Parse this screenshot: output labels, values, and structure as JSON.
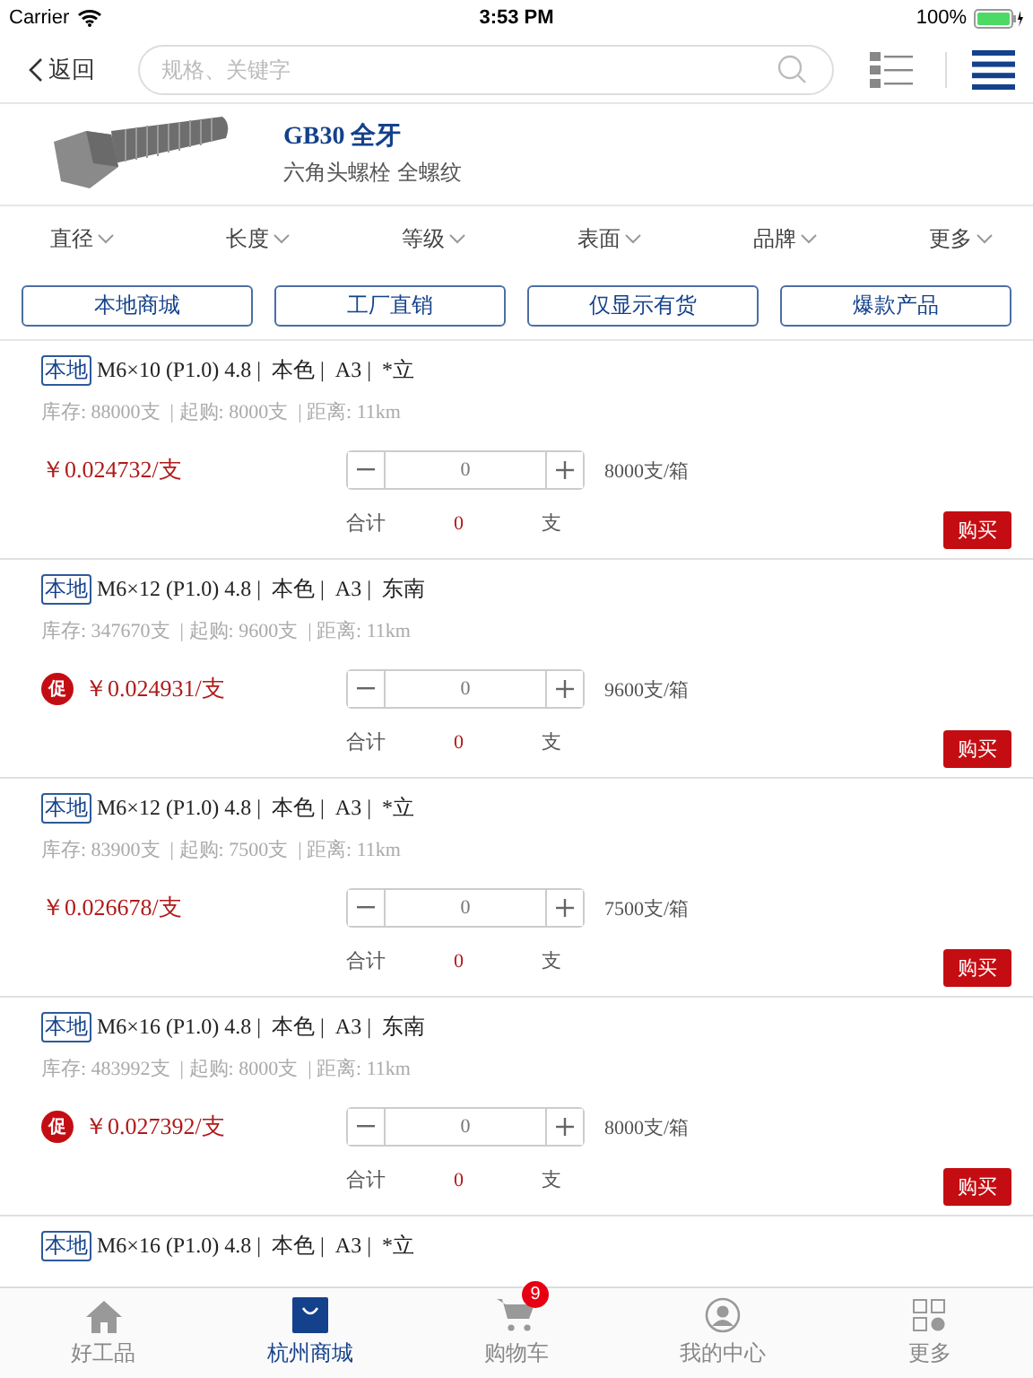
{
  "status_bar": {
    "carrier": "Carrier",
    "time": "3:53 PM",
    "battery": "100%"
  },
  "nav": {
    "back": "返回",
    "search": {
      "placeholder": "规格、关键字"
    }
  },
  "product": {
    "title": "GB30 全牙",
    "subtitle": "六角头螺栓 全螺纹"
  },
  "filters": [
    "直径",
    "长度",
    "等级",
    "表面",
    "品牌",
    "更多"
  ],
  "quick_buttons": [
    "本地商城",
    "工厂直销",
    "仅显示有货",
    "爆款产品"
  ],
  "items": [
    {
      "tag": "本地",
      "title": "M6×10 (P1.0) 4.8 |  本色 |  A3 |  *立",
      "stock": "库存: 88000支  | 起购: 8000支  | 距离: 11km",
      "promo": false,
      "price": "￥0.024732/支",
      "quantity": "0",
      "per_box": "8000支/箱",
      "total_label": "合计",
      "total": "0",
      "unit": "支",
      "buy": "购买"
    },
    {
      "tag": "本地",
      "title": "M6×12 (P1.0) 4.8 |  本色 |  A3 |  东南",
      "stock": "库存: 347670支  | 起购: 9600支  | 距离: 11km",
      "promo": true,
      "promo_label": "促",
      "price": "￥0.024931/支",
      "quantity": "0",
      "per_box": "9600支/箱",
      "total_label": "合计",
      "total": "0",
      "unit": "支",
      "buy": "购买"
    },
    {
      "tag": "本地",
      "title": "M6×12 (P1.0) 4.8 |  本色 |  A3 |  *立",
      "stock": "库存: 83900支  | 起购: 7500支  | 距离: 11km",
      "promo": false,
      "price": "￥0.026678/支",
      "quantity": "0",
      "per_box": "7500支/箱",
      "total_label": "合计",
      "total": "0",
      "unit": "支",
      "buy": "购买"
    },
    {
      "tag": "本地",
      "title": "M6×16 (P1.0) 4.8 |  本色 |  A3 |  东南",
      "stock": "库存: 483992支  | 起购: 8000支  | 距离: 11km",
      "promo": true,
      "promo_label": "促",
      "price": "￥0.027392/支",
      "quantity": "0",
      "per_box": "8000支/箱",
      "total_label": "合计",
      "total": "0",
      "unit": "支",
      "buy": "购买"
    },
    {
      "tag": "本地",
      "title": "M6×16 (P1.0) 4.8 |  本色 |  A3 |  *立"
    }
  ],
  "tab_bar": [
    {
      "kind": "home",
      "label": "好工品",
      "selected": false
    },
    {
      "kind": "shop",
      "label": "杭州商城",
      "selected": true
    },
    {
      "kind": "cart",
      "label": "购物车",
      "selected": false,
      "badge": "9"
    },
    {
      "kind": "user",
      "label": "我的中心",
      "selected": false
    },
    {
      "kind": "more",
      "label": "更多",
      "selected": false
    }
  ]
}
